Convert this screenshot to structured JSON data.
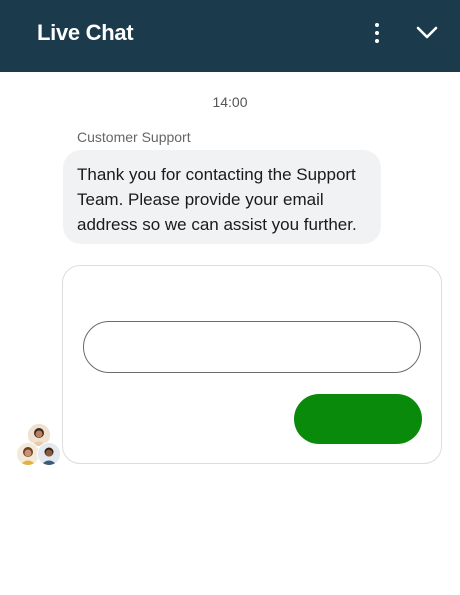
{
  "header": {
    "title": "Live Chat",
    "menu_icon": "more-vertical-icon",
    "collapse_icon": "chevron-down-icon",
    "background": "#1b3a4b"
  },
  "conversation": {
    "timestamp": "14:00",
    "sender": "Customer Support",
    "message": "Thank you for contacting the Support Team. Please provide your email address so we can assist you further."
  },
  "email_form": {
    "input_value": "",
    "submit_label": "",
    "submit_color": "#0a8a0a"
  },
  "agents": {
    "avatar_icon": "agent-avatars-icon"
  }
}
